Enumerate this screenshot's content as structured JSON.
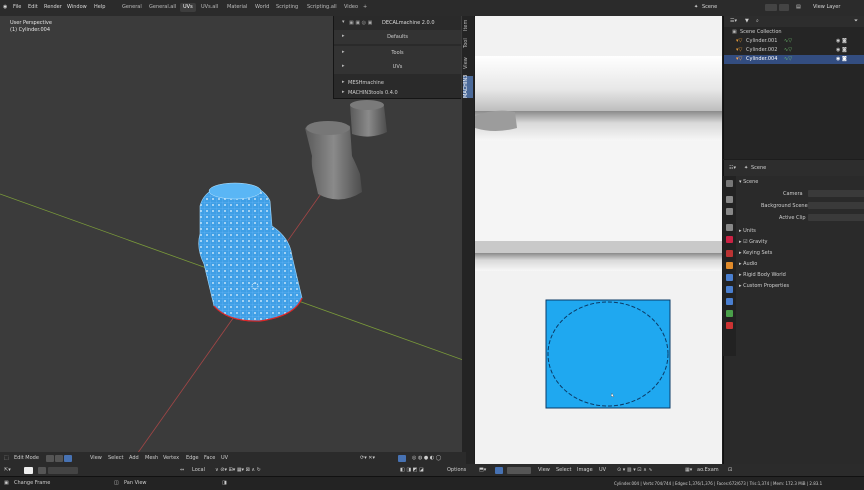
{
  "menu": {
    "items": [
      "File",
      "Edit",
      "Render",
      "Window",
      "Help"
    ],
    "workspaces": [
      "General",
      "General.all",
      "UVs",
      "UVs.all",
      "Material",
      "World",
      "Scripting",
      "Scripting.all",
      "Video"
    ],
    "active_workspace": "UVs",
    "add_tab": "+",
    "scene_label": "Scene",
    "view_layer_label": "View Layer"
  },
  "viewport": {
    "view_name": "User Perspective",
    "object_name": "(1) Cylinder.004",
    "mode": "Edit Mode",
    "header_items": [
      "View",
      "Select",
      "Add",
      "Mesh",
      "Vertex",
      "Edge",
      "Face",
      "UV"
    ],
    "transform_orientation": "Local",
    "options_label": "Options"
  },
  "npanel": {
    "addon_title": "DECALmachine 2.0.0",
    "rows": [
      "Defaults",
      "Tools",
      "UVs"
    ],
    "meshmachine": "MESHmachine",
    "machintools": "MACHIN3tools 0.4.0",
    "tabs": [
      "Item",
      "Tool",
      "View",
      "MACHIN3"
    ]
  },
  "image_editor": {
    "header_items": [
      "View",
      "Select",
      "Image",
      "UV"
    ],
    "image_name": "ao.Exam"
  },
  "outliner": {
    "rows": [
      {
        "name": "Scene Collection",
        "selected": false
      },
      {
        "name": "Cylinder.001",
        "selected": false
      },
      {
        "name": "Cylinder.002",
        "selected": false
      },
      {
        "name": "Cylinder.004",
        "selected": true
      }
    ]
  },
  "properties": {
    "header_scene": "Scene",
    "section_scene": "Scene",
    "camera_label": "Camera",
    "background_scene_label": "Background Scene",
    "active_clip_label": "Active Clip",
    "sections": [
      "Units",
      "Gravity",
      "Keying Sets",
      "Audio",
      "Rigid Body World",
      "Custom Properties"
    ]
  },
  "status": {
    "change_frame": "Change Frame",
    "pan_view": "Pan View",
    "stats": "Cylinder.004 | Verts:704/744 | Edges:1,376/1,376 | Faces:672/673 | Tris:1,374 | Mem: 172.3 MiB | 2.83.1"
  },
  "colors": {
    "accent": "#4772b3",
    "mesh_blue": "#3fa9f5",
    "uv_fill": "#1fa8f0"
  }
}
